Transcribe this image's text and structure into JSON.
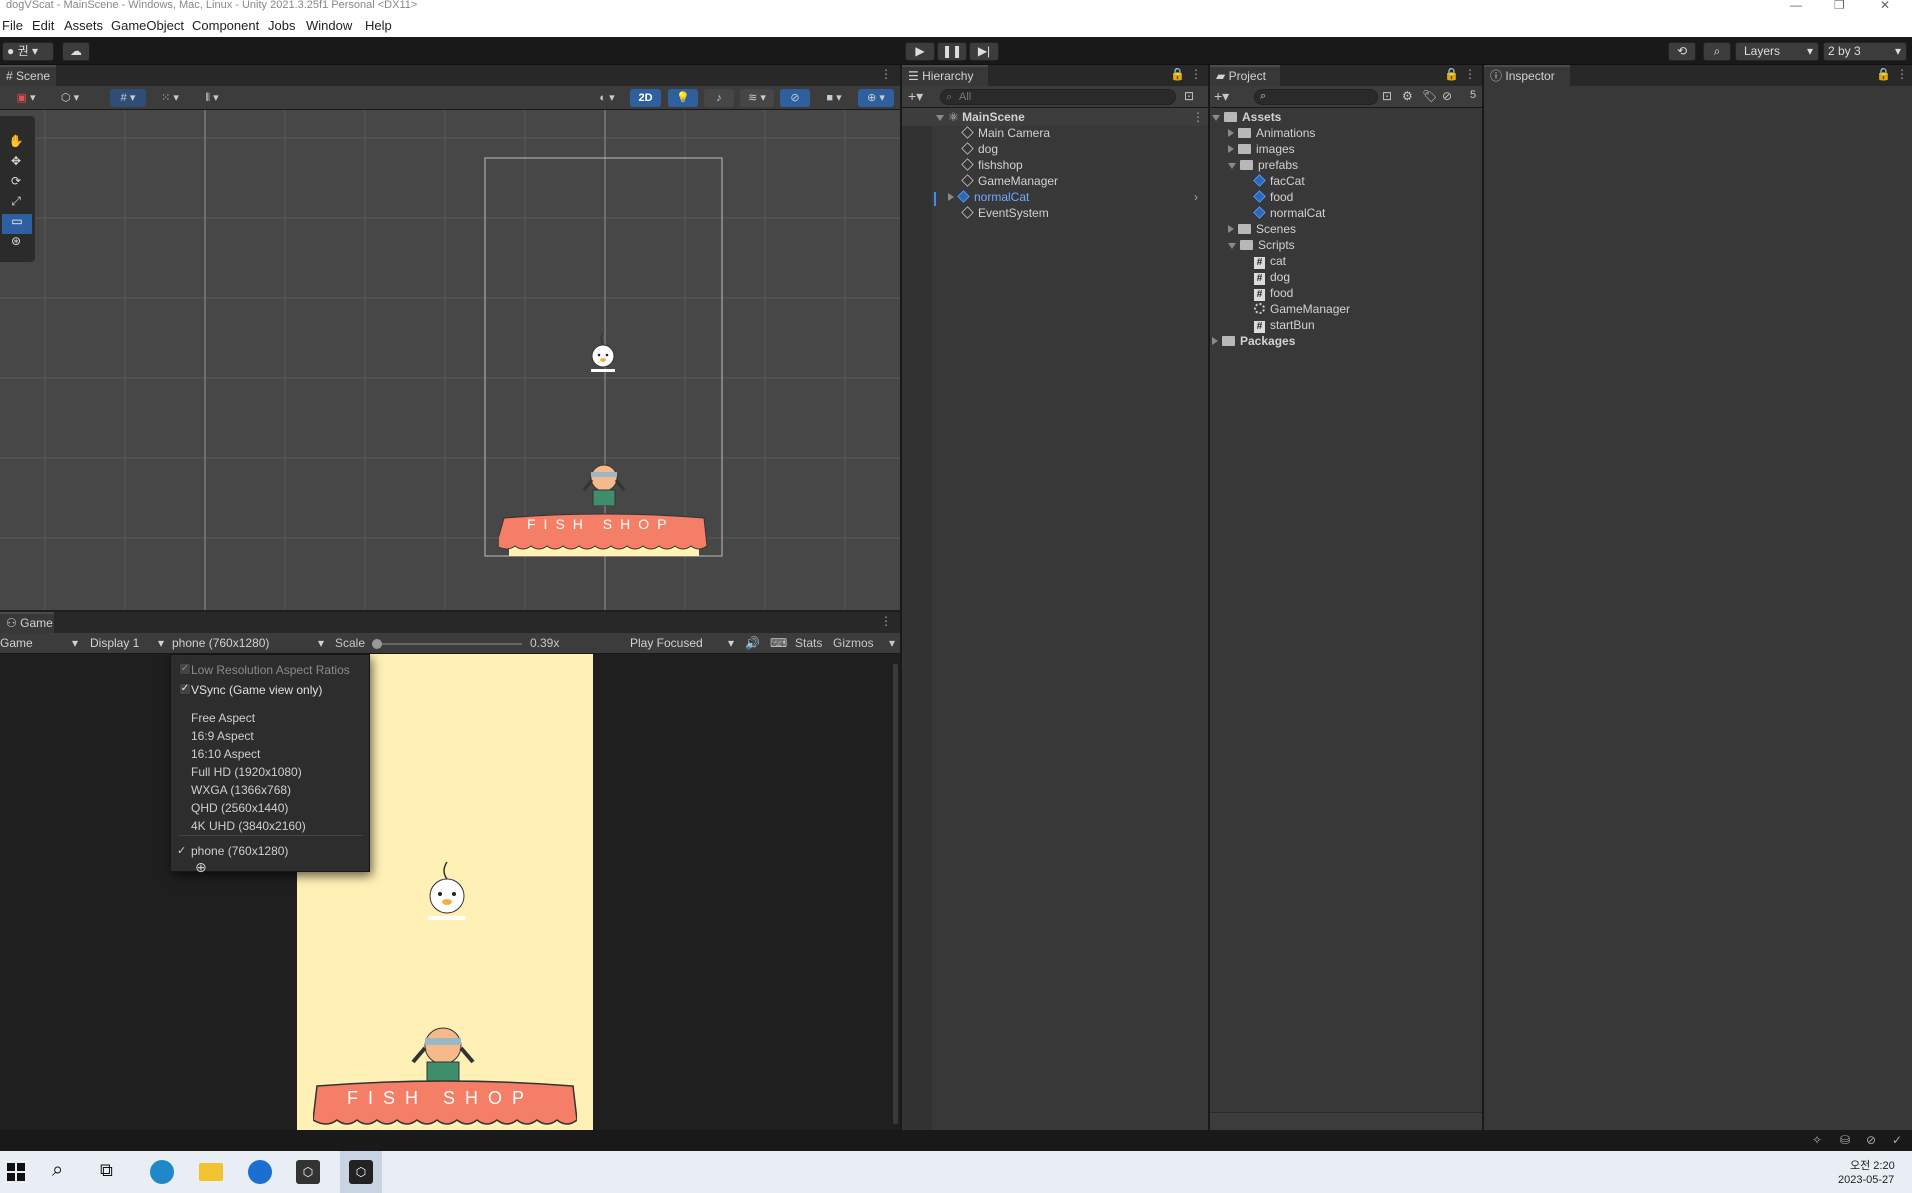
{
  "window": {
    "title": "dogVScat - MainScene - Windows, Mac, Linux - Unity 2021.3.25f1 Personal <DX11>",
    "controls": [
      "—",
      "❐",
      "✕"
    ]
  },
  "menu": [
    "File",
    "Edit",
    "Assets",
    "GameObject",
    "Component",
    "Jobs",
    "Window",
    "Help"
  ],
  "toolbar": {
    "account_label": "권",
    "play_icon": "play-icon",
    "pause_icon": "pause-icon",
    "step_icon": "step-icon",
    "layers_label": "Layers",
    "layout_label": "2 by 3"
  },
  "scene": {
    "tab_label": "Scene",
    "mode_2d_label": "2D",
    "shop_sign": "FISH SHOP"
  },
  "game": {
    "tab_label": "Game",
    "view_dropdown": "Game",
    "display_dropdown": "Display 1",
    "resolution_dropdown": "phone (760x1280)",
    "scale_label": "Scale",
    "scale_value": "0.39x",
    "scale_fraction": 0.0,
    "play_focused_label": "Play Focused",
    "stats_label": "Stats",
    "gizmos_label": "Gizmos",
    "shop_sign": "FISH SHOP"
  },
  "resolution_menu": {
    "low_res": "Low Resolution Aspect Ratios",
    "vsync": "VSync (Game view only)",
    "items": [
      "Free Aspect",
      "16:9 Aspect",
      "16:10 Aspect",
      "Full HD (1920x1080)",
      "WXGA (1366x768)",
      "QHD (2560x1440)",
      "4K UHD (3840x2160)"
    ],
    "selected": "phone (760x1280)"
  },
  "hierarchy": {
    "tab_label": "Hierarchy",
    "search_placeholder": "All",
    "scene_name": "MainScene",
    "objects": [
      "Main Camera",
      "dog",
      "fishshop",
      "GameManager",
      "normalCat",
      "EventSystem"
    ]
  },
  "project": {
    "tab_label": "Project",
    "hidden_count": "5",
    "assets_label": "Assets",
    "animations": "Animations",
    "images": "images",
    "prefabs": "prefabs",
    "prefab_items": [
      "facCat",
      "food",
      "normalCat"
    ],
    "scenes": "Scenes",
    "scripts": "Scripts",
    "script_items": [
      "cat",
      "dog",
      "food"
    ],
    "gamemanager": "GameManager",
    "startbun": "startBun",
    "packages": "Packages"
  },
  "inspector": {
    "tab_label": "Inspector"
  },
  "taskbar": {
    "time": "오전 2:20",
    "date": "2023-05-27"
  },
  "colors": {
    "game_bg": "#fff1b5",
    "shop_awning": "#f47e66",
    "accent_blue": "#3d6fbf"
  }
}
